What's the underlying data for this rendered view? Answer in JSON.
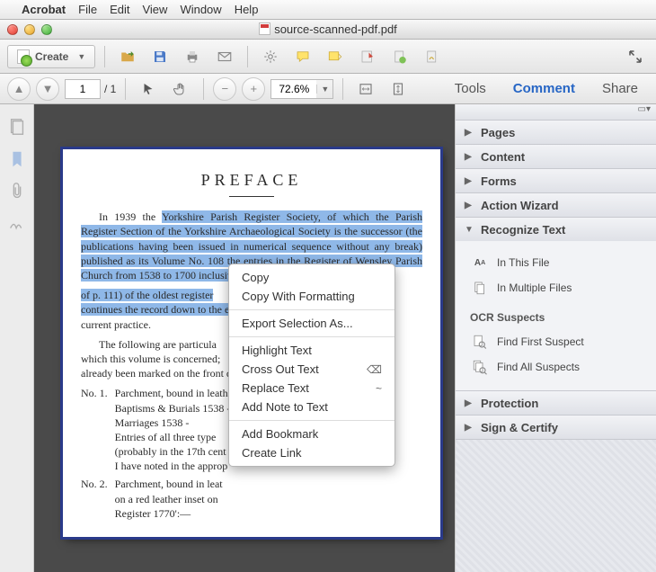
{
  "menubar": {
    "apple": "",
    "app": "Acrobat",
    "items": [
      "File",
      "Edit",
      "View",
      "Window",
      "Help"
    ]
  },
  "window": {
    "title": "source-scanned-pdf.pdf"
  },
  "toolbar": {
    "create_label": "Create"
  },
  "nav": {
    "page_current": "1",
    "page_total": "/  1",
    "zoom": "72.6%"
  },
  "tabs": {
    "tools": "Tools",
    "comment": "Comment",
    "share": "Share",
    "active": "comment"
  },
  "doc": {
    "title": "PREFACE",
    "p1a": "In 1939 the ",
    "p1_sel": "Yorkshire Parish Register Society, of which the Parish Register Section of the Yorkshire Archaeological Society is the successor (the publications having been issued in numerical sequence without any break) published as its Volume No. 108 the entries in the Register of Wensley Parish Church from 1538 to 1700 inclusive. These entries comprised",
    "p1b": "of p. 111) of the oldest register ",
    "p1c": "continues the record down to the e",
    "p1d": "current practice.",
    "p2": "The following are particula",
    "p2b": "which this volume is concerned;",
    "p2c": "already been marked on the front c",
    "no1_label": "No. 1.",
    "no1_text": "Parchment, bound in leath\nBaptisms & Burials 1538 -\nMarriages               1538 -\nEntries of all three type\n(probably in the 17th cent\nI have noted in the approp",
    "no2_label": "No. 2.",
    "no2_text": "Parchment, bound in leat\non a red leather inset on\nRegister 1770':—"
  },
  "ctx": {
    "copy": "Copy",
    "copyfmt": "Copy With Formatting",
    "export": "Export Selection As...",
    "highlight": "Highlight Text",
    "cross": "Cross Out Text",
    "replace": "Replace Text",
    "addnote": "Add Note to Text",
    "bookmark": "Add Bookmark",
    "link": "Create Link"
  },
  "panel": {
    "sections": {
      "pages": "Pages",
      "content": "Content",
      "forms": "Forms",
      "wizard": "Action Wizard",
      "recognize": "Recognize Text",
      "protection": "Protection",
      "sign": "Sign & Certify"
    },
    "recognize": {
      "in_this": "In This File",
      "in_multi": "In Multiple Files",
      "ocr_head": "OCR Suspects",
      "first": "Find First Suspect",
      "all": "Find All Suspects"
    }
  }
}
